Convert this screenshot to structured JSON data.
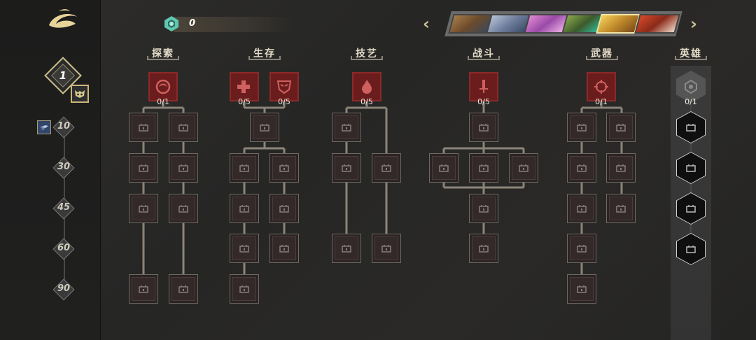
{
  "currency": {
    "amount": "0",
    "icon": "gem-icon",
    "color": "#5fc8b0"
  },
  "player_level": "1",
  "level_milestones": [
    "10",
    "30",
    "45",
    "60",
    "90"
  ],
  "categories": [
    {
      "label": "探索",
      "counts": [
        "0/1"
      ]
    },
    {
      "label": "生存",
      "counts": [
        "0/5",
        "0/5"
      ]
    },
    {
      "label": "技艺",
      "counts": [
        "0/5"
      ]
    },
    {
      "label": "战斗",
      "counts": [
        "0/5"
      ]
    },
    {
      "label": "武器",
      "counts": [
        "0/1"
      ]
    },
    {
      "label": "英雄",
      "counts": [
        "0/1"
      ]
    }
  ],
  "hero_portraits": {
    "count": 6,
    "selected_index": 4
  },
  "colors": {
    "accent": "#f2e4a6",
    "category_red": "#6b1d1d",
    "line": "#8b8579"
  }
}
